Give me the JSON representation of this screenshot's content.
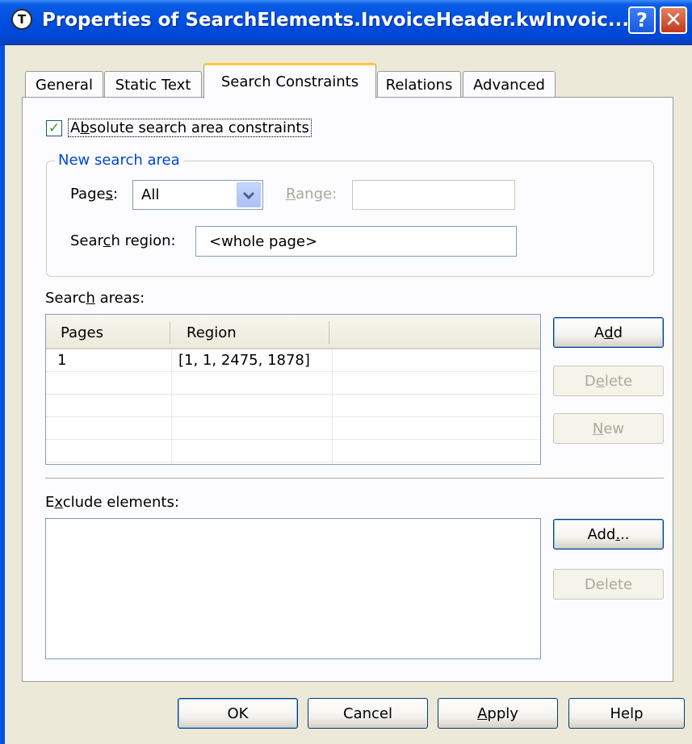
{
  "window": {
    "title": "Properties of SearchElements.InvoiceHeader.kwInvoic...",
    "app_icon": "T",
    "help_button": "?",
    "close_button": "✕"
  },
  "tabs": [
    {
      "label": "General",
      "active": false
    },
    {
      "label": "Static Text",
      "active": false
    },
    {
      "label": "Search Constraints",
      "active": true
    },
    {
      "label": "Relations",
      "active": false
    },
    {
      "label": "Advanced",
      "active": false
    }
  ],
  "constraints": {
    "absolute_checkbox": {
      "checked": true,
      "mark": "✓",
      "label_pre": "A",
      "label_ul": "b",
      "label_post": "solute search area constraints"
    },
    "group_title": "New search area",
    "pages_label": {
      "pre": "Page",
      "ul": "s",
      "post": ":"
    },
    "pages_value": "All",
    "range_label": {
      "pre": "",
      "ul": "R",
      "post": "ange:"
    },
    "range_value": "",
    "region_label": {
      "pre": "Sear",
      "ul": "c",
      "post": "h region:"
    },
    "region_value": "<whole page>"
  },
  "search_areas": {
    "label": {
      "pre": "Searc",
      "ul": "h",
      "post": " areas:"
    },
    "columns": [
      "Pages",
      "Region"
    ],
    "rows": [
      {
        "pages": "1",
        "region": "[1, 1, 2475, 1878]"
      }
    ],
    "buttons": {
      "add": {
        "pre": "A",
        "ul": "d",
        "post": "d"
      },
      "delete": {
        "pre": "D",
        "ul": "e",
        "post": "lete"
      },
      "new": {
        "pre": "",
        "ul": "N",
        "post": "ew"
      }
    }
  },
  "exclude": {
    "label": {
      "pre": "E",
      "ul": "x",
      "post": "clude elements:"
    },
    "buttons": {
      "add": {
        "pre": "Add",
        "ul": ".",
        "post": ".."
      },
      "delete": {
        "pre": "Delete",
        "ul": "",
        "post": ""
      }
    }
  },
  "footer": {
    "ok": "OK",
    "cancel": "Cancel",
    "apply": {
      "pre": "",
      "ul": "A",
      "post": "pply"
    },
    "help": "Help"
  },
  "colors": {
    "titlebar": "#0050e0",
    "dialog_bg": "#ece9d8",
    "tab_highlight": "#ffc83c",
    "group_title": "#0046d5",
    "disabled_text": "#aca899"
  }
}
